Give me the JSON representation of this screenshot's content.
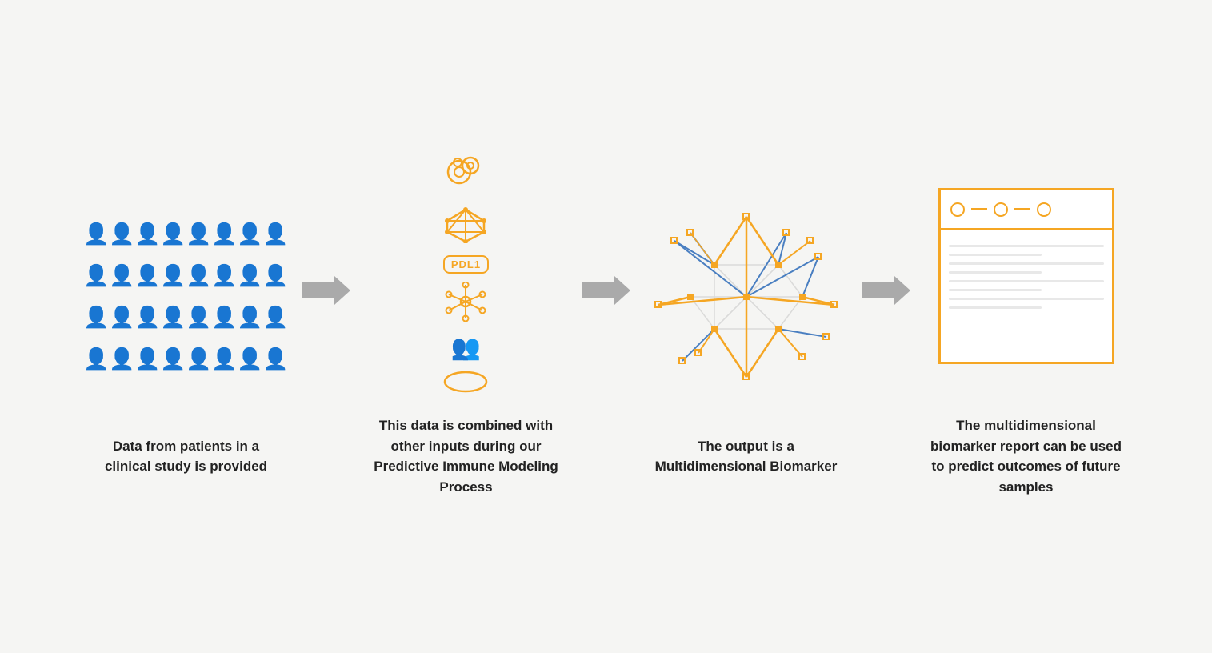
{
  "steps": [
    {
      "id": "step1",
      "caption": "Data from patients in a clinical study is provided",
      "icon_type": "people_grid"
    },
    {
      "id": "step2",
      "caption": "This data is combined with other inputs during our Predictive Immune Modeling Process",
      "icon_type": "inputs_stack"
    },
    {
      "id": "step3",
      "caption": "The output is a Multidimensional Biomarker",
      "icon_type": "network"
    },
    {
      "id": "step4",
      "caption": "The multidimensional biomarker report can be used to predict outcomes of future samples",
      "icon_type": "report"
    }
  ],
  "arrow_color": "#999999",
  "orange": "#f5a623",
  "blue": "#4a7fc1"
}
